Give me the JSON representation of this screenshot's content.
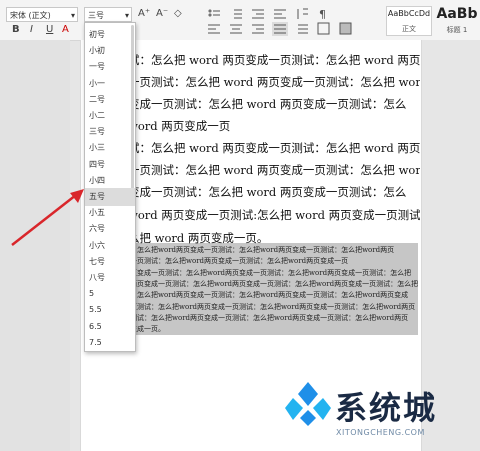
{
  "toolbar": {
    "font_name": "宋体 (正文)",
    "font_size": "三号",
    "font_name_arrow": "▾",
    "font_size_arrow": "▾",
    "grow_font": "A⁺",
    "shrink_font": "A⁻",
    "clear_format": "◇",
    "bold": "B",
    "italic": "I",
    "underline": "U",
    "font_color": "A"
  },
  "styles": [
    {
      "sample": "AaBbCcDd",
      "label": "正文"
    },
    {
      "sample": "AaBb",
      "label": "标题 1"
    }
  ],
  "font_size_options": [
    "初号",
    "小初",
    "一号",
    "小一",
    "二号",
    "小二",
    "三号",
    "小三",
    "四号",
    "小四",
    "五号",
    "小五",
    "六号",
    "小六",
    "七号",
    "八号",
    "5",
    "5.5",
    "6.5",
    "7.5"
  ],
  "font_size_highlighted": "五号",
  "document": {
    "lines": [
      "试：怎么把 word 两页变成一页测试：怎么把 word 两页变",
      "一页测试：怎么把 word 两页变成一页测试：怎么把 word",
      "变成一页测试：怎么把 word 两页变成一页测试：怎么",
      "word 两页变成一页",
      "试：怎么把 word 两页变成一页测试：怎么把 word 两页变",
      "一页测试：怎么把 word 两页变成一页测试：怎么把 word",
      "变成一页测试：怎么把 word 两页变成一页测试：怎么",
      "word 两页变成一页测试:怎么把 word 两页变成一页测试：",
      "么把 word 两页变成一页。"
    ],
    "small_lines": [
      "：怎么把word两页变成一页测试：怎么把word两页变成一页测试：怎么把word两页",
      "一页测试：怎么把word两页变成一页测试：怎么把word两页变成一页",
      "页变成一页测试：怎么把word两页变成一页测试：怎么把word两页变成一页测试：怎么把",
      "两页变成一页测试：怎么把word两页变成一页测试：怎么把word两页变成一页测试：怎么把",
      "：怎么把word两页变成一页测试：怎么把word两页变成一页测试：怎么把word两页变成",
      "页测试：怎么把word两页变成一页测试：怎么把word两页变成一页测试：怎么把word两页",
      "测试：怎么把word两页变成一页测试：怎么把word两页变成一页测试：怎么把word两页",
      "变成一页。"
    ]
  },
  "watermark": {
    "text": "系统城",
    "url": "XITONGCHENG.COM"
  },
  "colors": {
    "arrow": "#d9262b",
    "selection": "#c6c6c6",
    "logo_blue": "#1f8fe8"
  }
}
